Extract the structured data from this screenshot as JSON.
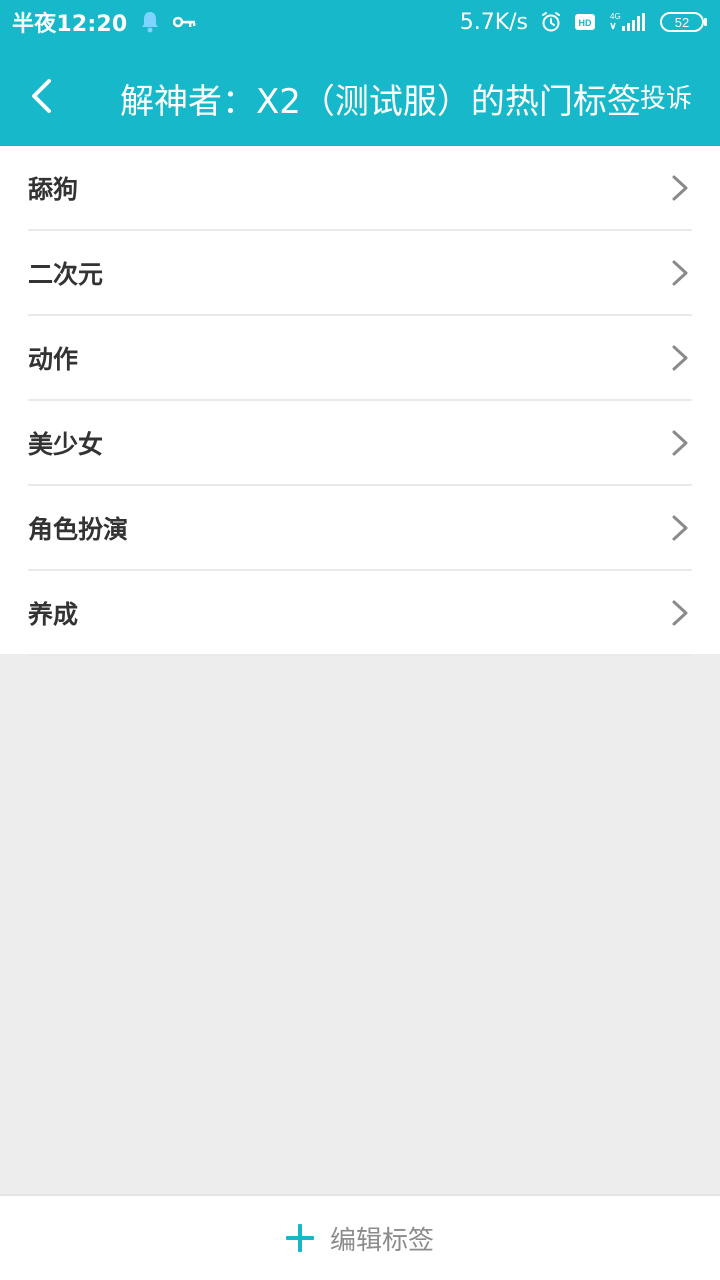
{
  "status": {
    "time": "半夜12:20",
    "speed": "5.7K/s",
    "network": "4G",
    "battery": "52",
    "icons": [
      "qq-bell-icon",
      "key-icon",
      "alarm-icon",
      "hd-icon",
      "signal-icon",
      "battery-icon"
    ]
  },
  "header": {
    "title": "解神者：X2（测试服）的热门标签",
    "report": "投诉"
  },
  "list": {
    "items": [
      {
        "label": "舔狗"
      },
      {
        "label": "二次元"
      },
      {
        "label": "动作"
      },
      {
        "label": "美少女"
      },
      {
        "label": "角色扮演"
      },
      {
        "label": "养成"
      }
    ]
  },
  "footer": {
    "edit_label": "编辑标签"
  },
  "colors": {
    "accent": "#16b8c9",
    "background": "#ededed",
    "text": "#333333"
  }
}
